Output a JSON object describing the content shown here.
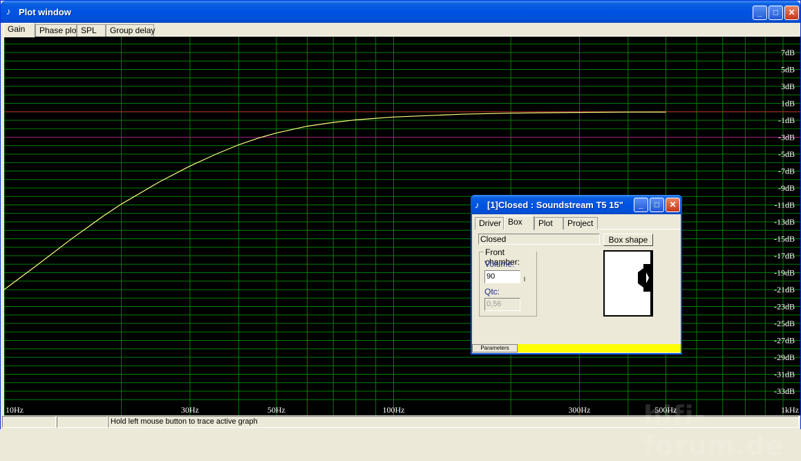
{
  "window": {
    "title": "Plot window",
    "tabs": [
      "Gain",
      "Phase plot",
      "SPL",
      "Group delay"
    ],
    "active_tab": "Gain",
    "minimize": "_",
    "maximize": "□",
    "close": "✕"
  },
  "status_bar": {
    "hint": "Hold left mouse button to trace active graph"
  },
  "watermark": "hifi-forum.de",
  "colors": {
    "plot_background": "#000000",
    "grid": "#008000",
    "curve": "#ffff80",
    "ref_line_0db": "#c02020",
    "ref_line_minus3db": "#a02080",
    "titlebar": "#0054e3",
    "params_bar": "#ffff00"
  },
  "chart_data": {
    "type": "line",
    "x_axis": {
      "scale": "log",
      "range_hz": [
        10,
        1000
      ],
      "tick_labels": [
        "10Hz",
        "30Hz",
        "50Hz",
        "100Hz",
        "300Hz",
        "500Hz",
        "1kHz"
      ],
      "tick_values": [
        10,
        30,
        50,
        100,
        300,
        500,
        1000
      ]
    },
    "y_axis": {
      "range_db": [
        -35,
        9
      ],
      "tick_labels": [
        "7dB",
        "5dB",
        "3dB",
        "1dB",
        "-1dB",
        "-3dB",
        "-5dB",
        "-7dB",
        "-9dB",
        "-11dB",
        "-13dB",
        "-15dB",
        "-17dB",
        "-19dB",
        "-21dB",
        "-23dB",
        "-25dB",
        "-27dB",
        "-29dB",
        "-31dB",
        "-33dB"
      ],
      "tick_values": [
        7,
        5,
        3,
        1,
        -1,
        -3,
        -5,
        -7,
        -9,
        -11,
        -13,
        -15,
        -17,
        -19,
        -21,
        -23,
        -25,
        -27,
        -29,
        -31,
        -33
      ]
    },
    "reference_lines_db": [
      0,
      -3
    ],
    "grid": true,
    "series": [
      {
        "x": [
          10,
          12,
          15,
          18,
          20,
          25,
          30,
          35,
          40,
          45,
          50,
          60,
          70,
          80,
          100,
          150,
          200,
          300,
          400,
          500
        ],
        "y": [
          -21.0,
          -18.3,
          -14.9,
          -12.3,
          -10.9,
          -8.3,
          -6.4,
          -5.0,
          -3.9,
          -3.1,
          -2.5,
          -1.7,
          -1.25,
          -0.95,
          -0.62,
          -0.28,
          -0.16,
          -0.07,
          -0.04,
          -0.03
        ]
      }
    ]
  },
  "child_window": {
    "title": "[1]Closed : Soundstream T5 15\"",
    "tabs": [
      "Driver",
      "Box",
      "Plot",
      "Project"
    ],
    "active_tab": "Box",
    "box_type": "Closed",
    "box_shape_label": "Box shape",
    "front_chamber": {
      "label": "Front chamber:",
      "volume_label": "Volume:",
      "volume_value": "90",
      "volume_unit": "l",
      "qtc_label": "Qtc:",
      "qtc_value": "0,56"
    },
    "params_tab": "Parameters"
  }
}
